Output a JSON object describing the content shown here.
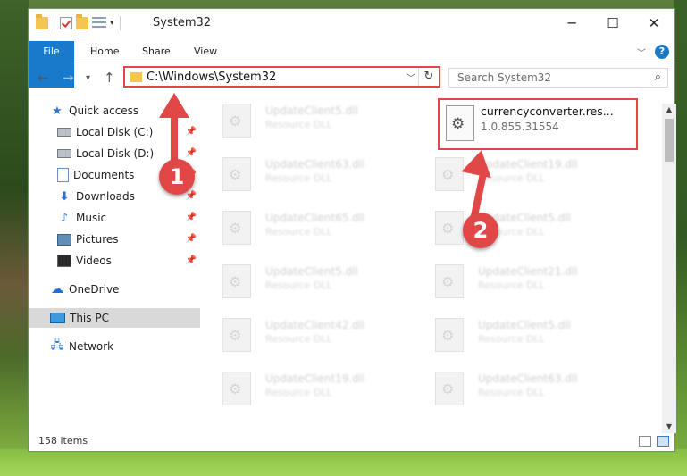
{
  "window": {
    "title": "System32",
    "controls": {
      "minimize": "─",
      "maximize": "☐",
      "close": "✕"
    }
  },
  "ribbon": {
    "tabs": [
      "File",
      "Home",
      "Share",
      "View"
    ],
    "help": "?"
  },
  "address": {
    "path": "C:\\Windows\\System32",
    "search_placeholder": "Search System32"
  },
  "sidebar": {
    "items": [
      {
        "label": "Quick access",
        "icon": "star-icon"
      },
      {
        "label": "Local Disk (C:)",
        "icon": "drive-icon",
        "pinned": true
      },
      {
        "label": "Local Disk (D:)",
        "icon": "drive-icon",
        "pinned": true
      },
      {
        "label": "Documents",
        "icon": "documents-icon",
        "pinned": true
      },
      {
        "label": "Downloads",
        "icon": "downloads-icon",
        "pinned": true
      },
      {
        "label": "Music",
        "icon": "music-icon",
        "pinned": true
      },
      {
        "label": "Pictures",
        "icon": "pictures-icon",
        "pinned": true
      },
      {
        "label": "Videos",
        "icon": "videos-icon",
        "pinned": true
      },
      {
        "label": "OneDrive",
        "icon": "cloud-icon"
      },
      {
        "label": "This PC",
        "icon": "pc-icon",
        "selected": true
      },
      {
        "label": "Network",
        "icon": "network-icon"
      }
    ]
  },
  "files": [
    {
      "name": "UpdateClient5.dll",
      "type": "Resource DLL"
    },
    {
      "name": "UpdateClient63.dll",
      "type": "Resource DLL"
    },
    {
      "name": "UpdateClient19.dll",
      "type": "Resource DLL"
    },
    {
      "name": "UpdateClient65.dll",
      "type": "Resource DLL"
    },
    {
      "name": "UpdateClient5.dll",
      "type": "Resource DLL"
    },
    {
      "name": "UpdateClient5.dll",
      "type": "Resource DLL"
    },
    {
      "name": "UpdateClient21.dll",
      "type": "Resource DLL"
    },
    {
      "name": "UpdateClient42.dll",
      "type": "Resource DLL"
    },
    {
      "name": "UpdateClient5.dll",
      "type": "Resource DLL"
    },
    {
      "name": "UpdateClient19.dll",
      "type": "Resource DLL"
    },
    {
      "name": "UpdateClient63.dll",
      "type": "Resource DLL"
    }
  ],
  "highlighted_file": {
    "name": "currencyconverter.res...",
    "version": "1.0.855.31554"
  },
  "status": {
    "count": "158 items"
  },
  "annotations": [
    "1",
    "2"
  ],
  "colors": {
    "accent": "#1979ca",
    "highlight": "#e04848"
  }
}
